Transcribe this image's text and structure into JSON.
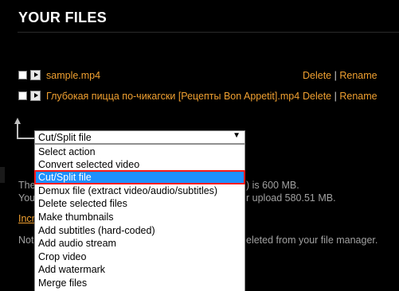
{
  "page": {
    "title": "YOUR FILES"
  },
  "files": [
    {
      "name": "sample.mp4",
      "delete_label": "Delete",
      "separator": "|",
      "rename_label": "Rename"
    },
    {
      "name": "Глубокая пицца по-чикагски [Рецепты Bon Appetit].mp4",
      "delete_label": "Delete",
      "separator": "|",
      "rename_label": "Rename"
    }
  ],
  "action_select": {
    "current_value": "Cut/Split file",
    "caret": "▼",
    "options": [
      "Select action",
      "Convert selected video",
      "Cut/Split file",
      "Demux file (extract video/audio/subtitles)",
      "Delete selected files",
      "Make thumbnails",
      "Add subtitles (hard-coded)",
      "Add audio stream",
      "Crop video",
      "Add watermark",
      "Merge files"
    ],
    "highlighted_option": "Cut/Split file"
  },
  "background_fragments": {
    "line1_left": "The",
    "line1_right": ") is 600 MB.",
    "line2_left": "You",
    "line2_right": "r upload 580.51 MB.",
    "link_fragment": "Incr",
    "line3_left": "Not",
    "line3_right": "eleted from your file manager."
  }
}
